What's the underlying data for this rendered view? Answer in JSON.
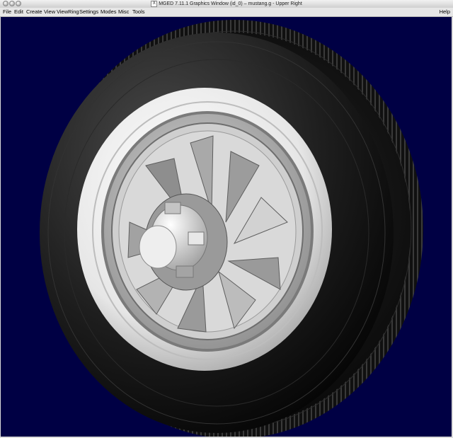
{
  "window": {
    "title": "MGED 7.11.1 Graphics Window (id_0) – mustang.g - Upper Right"
  },
  "menu": {
    "items": [
      "File",
      "Edit",
      "Create",
      "View",
      "ViewRing",
      "Settings",
      "Modes",
      "Misc",
      "Tools"
    ],
    "help": "Help"
  },
  "viewport": {
    "background": "#000044",
    "content": "wheel-render"
  }
}
